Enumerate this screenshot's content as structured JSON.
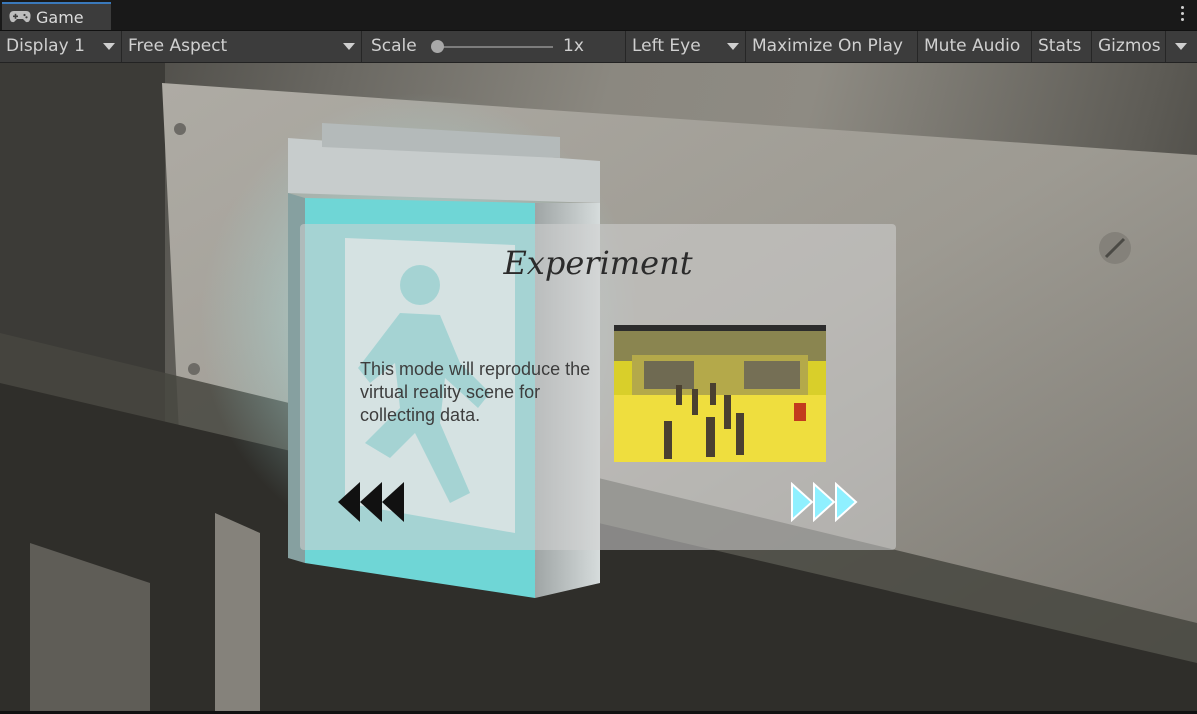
{
  "tab": {
    "label": "Game",
    "icon": "gamepad-icon"
  },
  "toolbar": {
    "display": "Display 1",
    "aspect": "Free Aspect",
    "scale_label": "Scale",
    "scale_value": "1x",
    "eye": "Left Eye",
    "maximize": "Maximize On Play",
    "mute": "Mute Audio",
    "stats": "Stats",
    "gizmos": "Gizmos"
  },
  "panel": {
    "title": "Experiment",
    "description": "This mode will reproduce the virtual reality scene for collecting data.",
    "prev_icon": "rewind-icon",
    "next_icon": "fast-forward-icon"
  },
  "colors": {
    "accent_tab": "#3a79bb",
    "toolbar_bg": "#3c3c3c",
    "exit_sign": "#35c4cc",
    "next_arrow": "#8ff0ff"
  }
}
